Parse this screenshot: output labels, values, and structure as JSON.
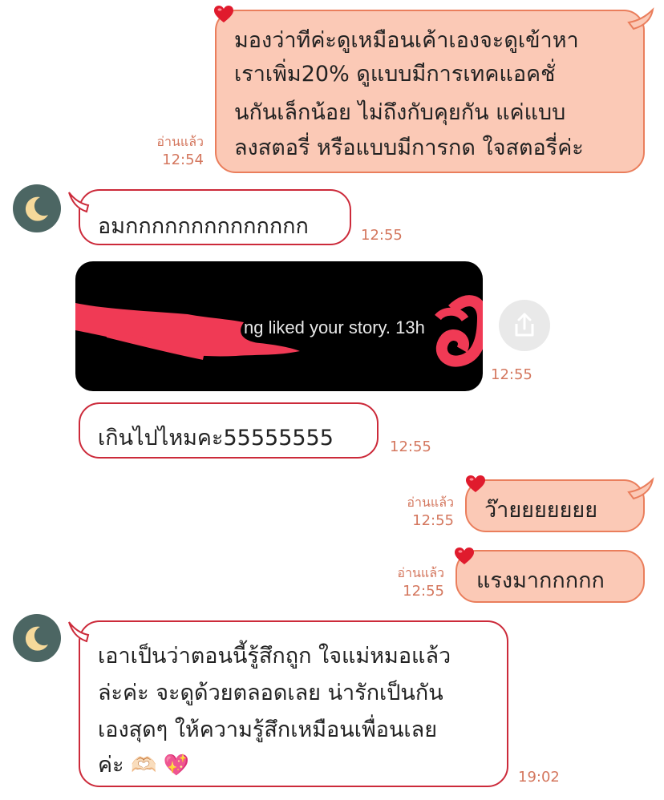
{
  "messages": [
    {
      "id": "m1",
      "direction": "outgoing",
      "lines": [
        "มองว่าทีค่ะดูเหมือนเค้าเองจะดูเข้าหา",
        "เราเพิ่ม20% ดูแบบมีการเทคแอคชั่",
        "นกันเล็กน้อย ไม่ถึงกับคุยกัน แค่แบบ",
        "ลงสตอรี่ หรือแบบมีการกด ใจสตอรี่ค่ะ"
      ],
      "read": "อ่านแล้ว",
      "time": "12:54",
      "reaction": "heart-icon"
    },
    {
      "id": "m2",
      "direction": "incoming",
      "lines": [
        "อมกกกกกกกกกกกกกก"
      ],
      "time": "12:55"
    },
    {
      "id": "m3",
      "direction": "incoming",
      "type": "image",
      "caption": "ng liked your story. 13h",
      "time": "12:55",
      "share_icon": "share-icon"
    },
    {
      "id": "m4",
      "direction": "incoming",
      "lines": [
        "เกินไปไหมคะ55555555"
      ],
      "time": "12:55"
    },
    {
      "id": "m5",
      "direction": "outgoing",
      "lines": [
        "ว๊ายยยยยยย"
      ],
      "read": "อ่านแล้ว",
      "time": "12:55",
      "reaction": "heart-icon"
    },
    {
      "id": "m6",
      "direction": "outgoing",
      "lines": [
        "แรงมากกกกก"
      ],
      "read": "อ่านแล้ว",
      "time": "12:55",
      "reaction": "heart-icon"
    },
    {
      "id": "m7",
      "direction": "incoming",
      "lines": [
        "เอาเป็นว่าตอนนี้รู้สึกถูก ใจแม่หมอแล้ว",
        "ล่ะค่ะ จะดูด้วยตลอดเลย น่ารักเป็นกัน",
        "เองสุดๆ ให้ความรู้สึกเหมือนเพื่อนเลย",
        "ค่ะ"
      ],
      "emojis": "🫶🏻 💖",
      "time": "19:02"
    }
  ],
  "contact": {
    "avatar_icon": "moon-icon"
  },
  "colors": {
    "outgoing_fill": "#fbc9b6",
    "outgoing_border": "#ea7e5c",
    "incoming_border": "#cc2a3a",
    "meta_text": "#d4775e",
    "avatar_bg": "#4c6663",
    "moon": "#f6d99a"
  }
}
